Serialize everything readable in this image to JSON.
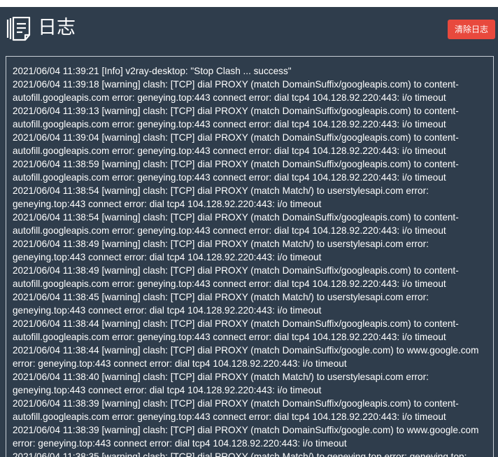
{
  "header": {
    "title": "日志",
    "clear_button_label": "清除日志"
  },
  "icons": {
    "logo": "log-stack-icon"
  },
  "colors": {
    "background": "#2f3d4c",
    "text": "#ffffff",
    "clear_button": "#e8493d",
    "panel_border": "#c9cfd6"
  },
  "log": {
    "entries": [
      "2021/06/04 11:39:21 [Info] v2ray-desktop: \"Stop Clash ... success\"",
      "2021/06/04 11:39:18 [warning] clash: [TCP] dial PROXY (match DomainSuffix/googleapis.com) to content-autofill.googleapis.com error: geneying.top:443 connect error: dial tcp4 104.128.92.220:443: i/o timeout",
      "2021/06/04 11:39:13 [warning] clash: [TCP] dial PROXY (match DomainSuffix/googleapis.com) to content-autofill.googleapis.com error: geneying.top:443 connect error: dial tcp4 104.128.92.220:443: i/o timeout",
      "2021/06/04 11:39:04 [warning] clash: [TCP] dial PROXY (match DomainSuffix/googleapis.com) to content-autofill.googleapis.com error: geneying.top:443 connect error: dial tcp4 104.128.92.220:443: i/o timeout",
      "2021/06/04 11:38:59 [warning] clash: [TCP] dial PROXY (match DomainSuffix/googleapis.com) to content-autofill.googleapis.com error: geneying.top:443 connect error: dial tcp4 104.128.92.220:443: i/o timeout",
      "2021/06/04 11:38:54 [warning] clash: [TCP] dial PROXY (match Match/) to userstylesapi.com error: geneying.top:443 connect error: dial tcp4 104.128.92.220:443: i/o timeout",
      "2021/06/04 11:38:54 [warning] clash: [TCP] dial PROXY (match DomainSuffix/googleapis.com) to content-autofill.googleapis.com error: geneying.top:443 connect error: dial tcp4 104.128.92.220:443: i/o timeout",
      "2021/06/04 11:38:49 [warning] clash: [TCP] dial PROXY (match Match/) to userstylesapi.com error: geneying.top:443 connect error: dial tcp4 104.128.92.220:443: i/o timeout",
      "2021/06/04 11:38:49 [warning] clash: [TCP] dial PROXY (match DomainSuffix/googleapis.com) to content-autofill.googleapis.com error: geneying.top:443 connect error: dial tcp4 104.128.92.220:443: i/o timeout",
      "2021/06/04 11:38:45 [warning] clash: [TCP] dial PROXY (match Match/) to userstylesapi.com error: geneying.top:443 connect error: dial tcp4 104.128.92.220:443: i/o timeout",
      "2021/06/04 11:38:44 [warning] clash: [TCP] dial PROXY (match DomainSuffix/googleapis.com) to content-autofill.googleapis.com error: geneying.top:443 connect error: dial tcp4 104.128.92.220:443: i/o timeout",
      "2021/06/04 11:38:44 [warning] clash: [TCP] dial PROXY (match DomainSuffix/google.com) to www.google.com error: geneying.top:443 connect error: dial tcp4 104.128.92.220:443: i/o timeout",
      "2021/06/04 11:38:40 [warning] clash: [TCP] dial PROXY (match Match/) to userstylesapi.com error: geneying.top:443 connect error: dial tcp4 104.128.92.220:443: i/o timeout",
      "2021/06/04 11:38:39 [warning] clash: [TCP] dial PROXY (match DomainSuffix/googleapis.com) to content-autofill.googleapis.com error: geneying.top:443 connect error: dial tcp4 104.128.92.220:443: i/o timeout",
      "2021/06/04 11:38:39 [warning] clash: [TCP] dial PROXY (match DomainSuffix/google.com) to www.google.com error: geneying.top:443 connect error: dial tcp4 104.128.92.220:443: i/o timeout",
      "2021/06/04 11:38:35 [warning] clash: [TCP] dial PROXY (match Match/) to geneying.top error: geneying.top:"
    ]
  }
}
